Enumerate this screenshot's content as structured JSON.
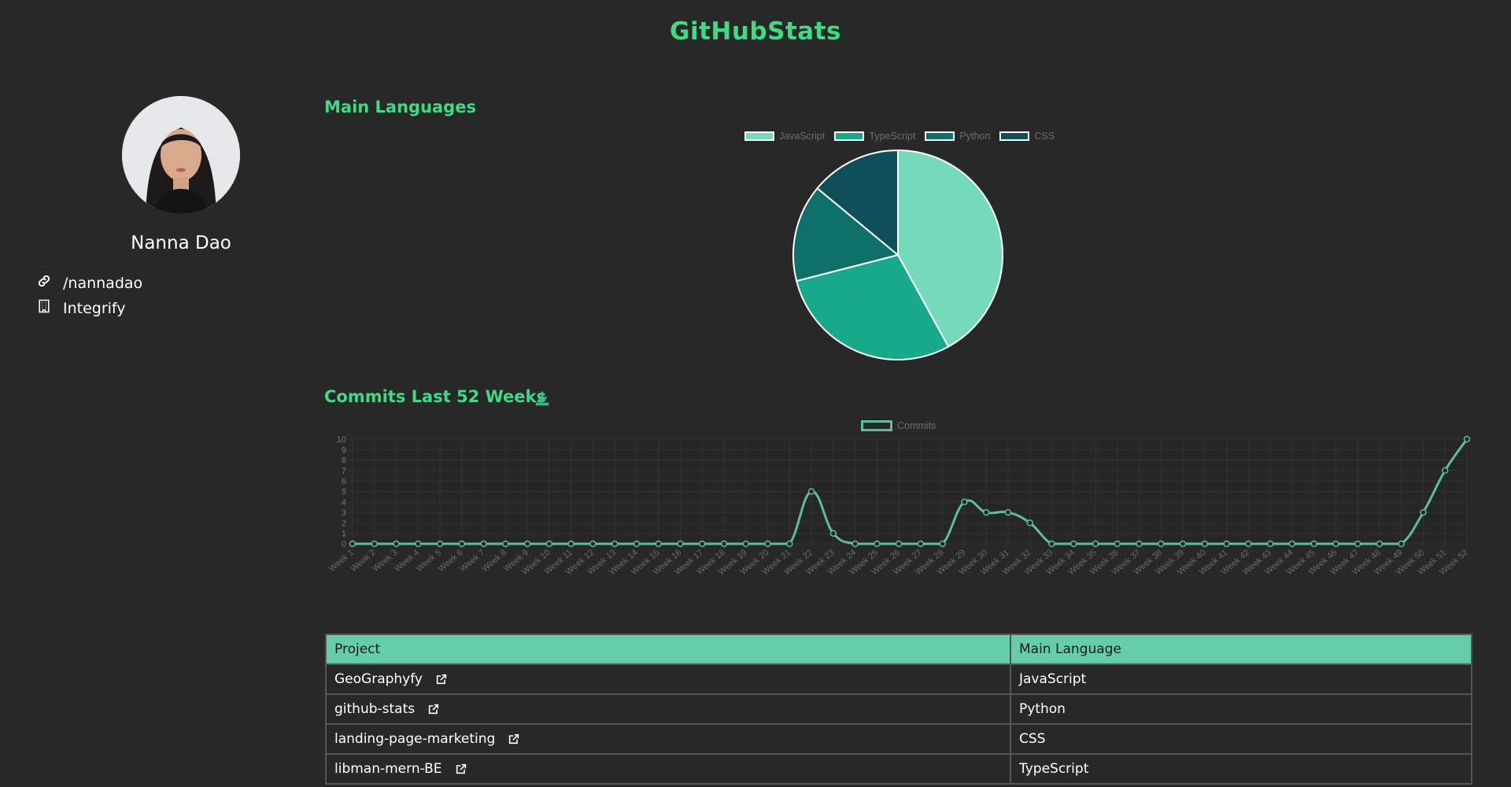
{
  "header": {
    "title": "GitHubStats"
  },
  "profile": {
    "name": "Nanna Dao",
    "link": "/nannadao",
    "company": "Integrify"
  },
  "sections": {
    "languages_title": "Main Languages",
    "commits_title": "Commits Last 52 Weeks"
  },
  "colors": {
    "accent": "#3ddc84",
    "table_header": "#66cdaa",
    "line": "#5bbf97",
    "pie": [
      "#75d9bb",
      "#16a98a",
      "#0d716a",
      "#0f4f5a"
    ]
  },
  "chart_data": [
    {
      "type": "pie",
      "title": "",
      "legend_position": "top",
      "labels": [
        "JavaScript",
        "TypeScript",
        "Python",
        "CSS"
      ],
      "values": [
        42,
        29,
        15,
        14
      ]
    },
    {
      "type": "line",
      "title": "",
      "legend_position": "top",
      "grid": true,
      "ylim": [
        0,
        10
      ],
      "yticks": [
        0,
        1,
        2,
        3,
        4,
        5,
        6,
        7,
        8,
        9,
        10
      ],
      "categories": [
        "Week 1",
        "Week 2",
        "Week 3",
        "Week 4",
        "Week 5",
        "Week 6",
        "Week 7",
        "Week 8",
        "Week 9",
        "Week 10",
        "Week 11",
        "Week 12",
        "Week 13",
        "Week 14",
        "Week 15",
        "Week 16",
        "Week 17",
        "Week 18",
        "Week 19",
        "Week 20",
        "Week 21",
        "Week 22",
        "Week 23",
        "Week 24",
        "Week 25",
        "Week 26",
        "Week 27",
        "Week 28",
        "Week 29",
        "Week 30",
        "Week 31",
        "Week 32",
        "Week 33",
        "Week 34",
        "Week 35",
        "Week 36",
        "Week 37",
        "Week 38",
        "Week 39",
        "Week 40",
        "Week 41",
        "Week 42",
        "Week 43",
        "Week 44",
        "Week 45",
        "Week 46",
        "Week 47",
        "Week 48",
        "Week 49",
        "Week 50",
        "Week 51",
        "Week 52"
      ],
      "series": [
        {
          "name": "Commits",
          "values": [
            0,
            0,
            0,
            0,
            0,
            0,
            0,
            0,
            0,
            0,
            0,
            0,
            0,
            0,
            0,
            0,
            0,
            0,
            0,
            0,
            0,
            5,
            1,
            0,
            0,
            0,
            0,
            0,
            4,
            3,
            3,
            2,
            0,
            0,
            0,
            0,
            0,
            0,
            0,
            0,
            0,
            0,
            0,
            0,
            0,
            0,
            0,
            0,
            0,
            3,
            7,
            10
          ]
        }
      ]
    }
  ],
  "table": {
    "headers": [
      "Project",
      "Main Language"
    ],
    "rows": [
      {
        "project": "GeoGraphyfy",
        "language": "JavaScript"
      },
      {
        "project": "github-stats",
        "language": "Python"
      },
      {
        "project": "landing-page-marketing",
        "language": "CSS"
      },
      {
        "project": "libman-mern-BE",
        "language": "TypeScript"
      }
    ]
  }
}
